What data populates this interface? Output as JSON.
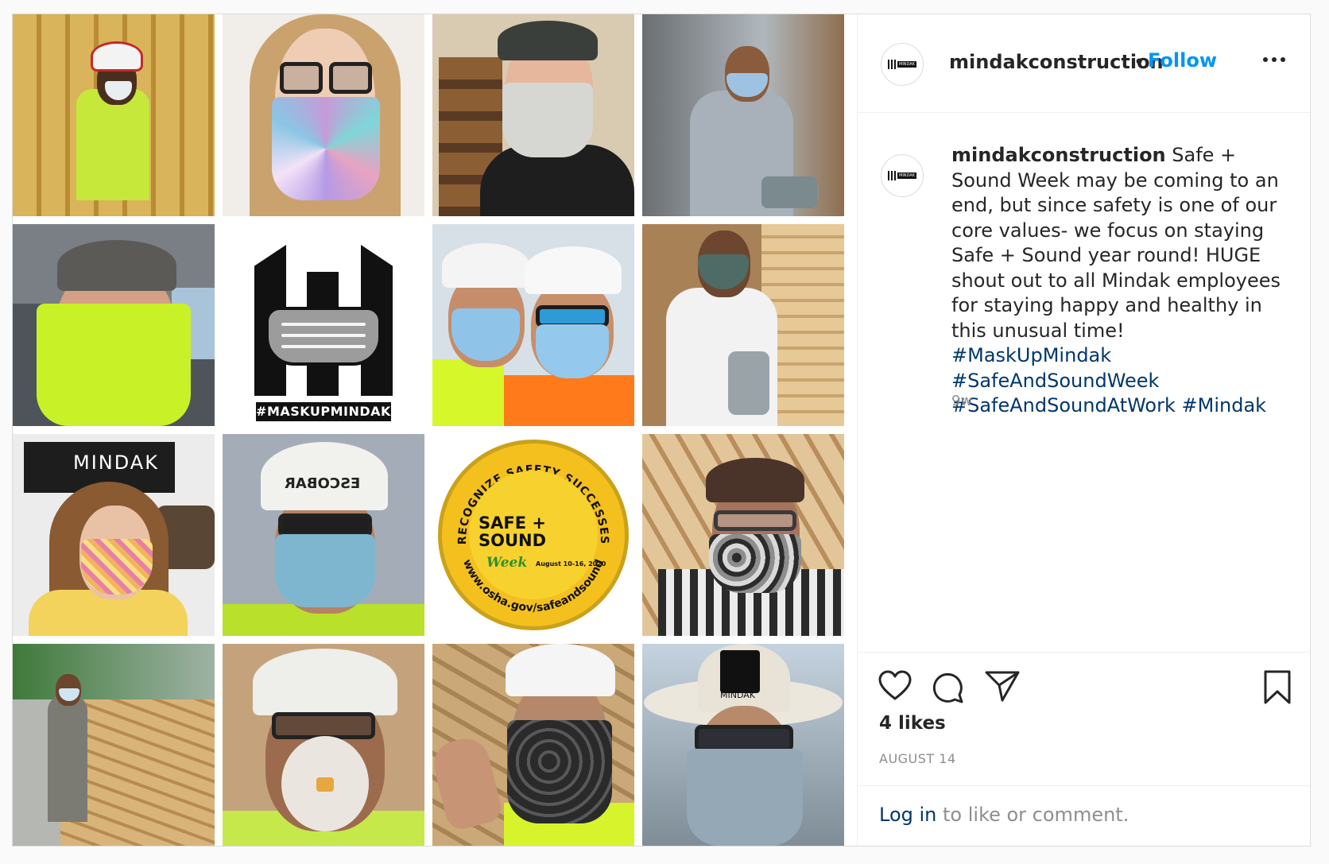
{
  "post": {
    "username": "mindakconstruction",
    "follow_label": "Follow",
    "separator": "•",
    "caption": {
      "username": "mindakconstruction",
      "text": " Safe + Sound Week may be coming to an end, but since safety is one of our core values- we focus on staying Safe + Sound year round! HUGE shout out to all Mindak employees for staying happy and healthy in this unusual time! ",
      "hashtags": [
        "#MaskUpMindak",
        "#SafeAndSoundWeek",
        "#SafeAndSoundAtWork",
        "#Mindak"
      ],
      "age": "9w"
    },
    "likes": "4 likes",
    "date": "AUGUST 14",
    "login": {
      "link": "Log in",
      "rest": " to like or comment."
    },
    "avatar_label": "MINDAK"
  },
  "media": {
    "logo_tag": "#MASKUPMINDAK",
    "badge": {
      "top_arc": "RECOGNIZE SAFETY SUCCESSES",
      "title": "SAFE + SOUND",
      "week": "Week",
      "dates": "August 10-16, 2020",
      "url": "www.osha.gov/safeandsound"
    },
    "sign_text": "MINDAK",
    "helmet_text": "ESCOBAR",
    "shirt_text": "MINDAK"
  },
  "icons": [
    "heart-icon",
    "comment-icon",
    "share-icon",
    "bookmark-icon",
    "more-icon"
  ],
  "colors": {
    "link_blue": "#0095f6",
    "hashtag_blue": "#00376b",
    "muted_text": "#8e8e8e",
    "badge_yellow": "#f4c01e"
  }
}
